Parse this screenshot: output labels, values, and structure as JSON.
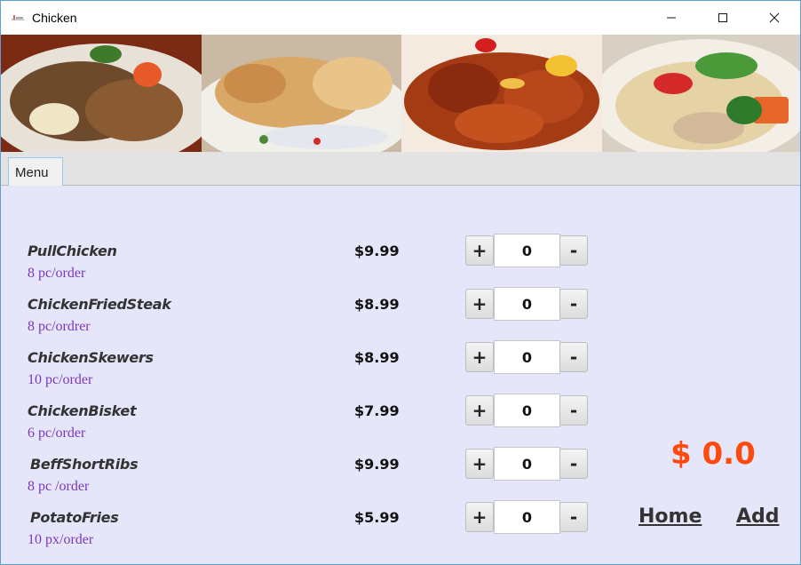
{
  "window": {
    "title": "Chicken",
    "app_icon": "app-icon"
  },
  "banner": {
    "photos": [
      {
        "icon": "dish-photo-1",
        "colors": {
          "plate": "#e8e1d7",
          "food": "#6d4a2b"
        }
      },
      {
        "icon": "dish-photo-2",
        "colors": {
          "plate": "#f0efe9",
          "food": "#d9a867"
        }
      },
      {
        "icon": "dish-photo-3",
        "colors": {
          "plate": "#f5eadf",
          "food": "#a53b14"
        }
      },
      {
        "icon": "dish-photo-4",
        "colors": {
          "plate": "#f3efe6",
          "food": "#e6d3a5"
        }
      }
    ]
  },
  "tabs": [
    {
      "label": "Menu"
    }
  ],
  "menu": {
    "items": [
      {
        "name": "PullChicken",
        "portion": "8 pc/order",
        "price": "$9.99",
        "qty": "0",
        "plus": "+",
        "minus": "-"
      },
      {
        "name": "ChickenFriedSteak",
        "portion": "8 pc/ordrer",
        "price": "$8.99",
        "qty": "0",
        "plus": "+",
        "minus": "-"
      },
      {
        "name": "ChickenSkewers",
        "portion": "10 pc/order",
        "price": "$8.99",
        "qty": "0",
        "plus": "+",
        "minus": "-"
      },
      {
        "name": "ChickenBisket",
        "portion": "6 pc/order",
        "price": "$7.99",
        "qty": "0",
        "plus": "+",
        "minus": "-"
      },
      {
        "name": "BeffShortRibs",
        "portion": "8 pc /order",
        "price": "$9.99",
        "qty": "0",
        "plus": "+",
        "minus": "-"
      },
      {
        "name": "PotatoFries",
        "portion": "10 px/order",
        "price": "$5.99",
        "qty": "0",
        "plus": "+",
        "minus": "-"
      }
    ]
  },
  "summary": {
    "total": "$ 0.0",
    "home_label": "Home",
    "add_label": "Add"
  },
  "colors": {
    "content_bg": "#e6e6fa",
    "total": "#ff4a0f",
    "portion": "#7a37b8"
  }
}
